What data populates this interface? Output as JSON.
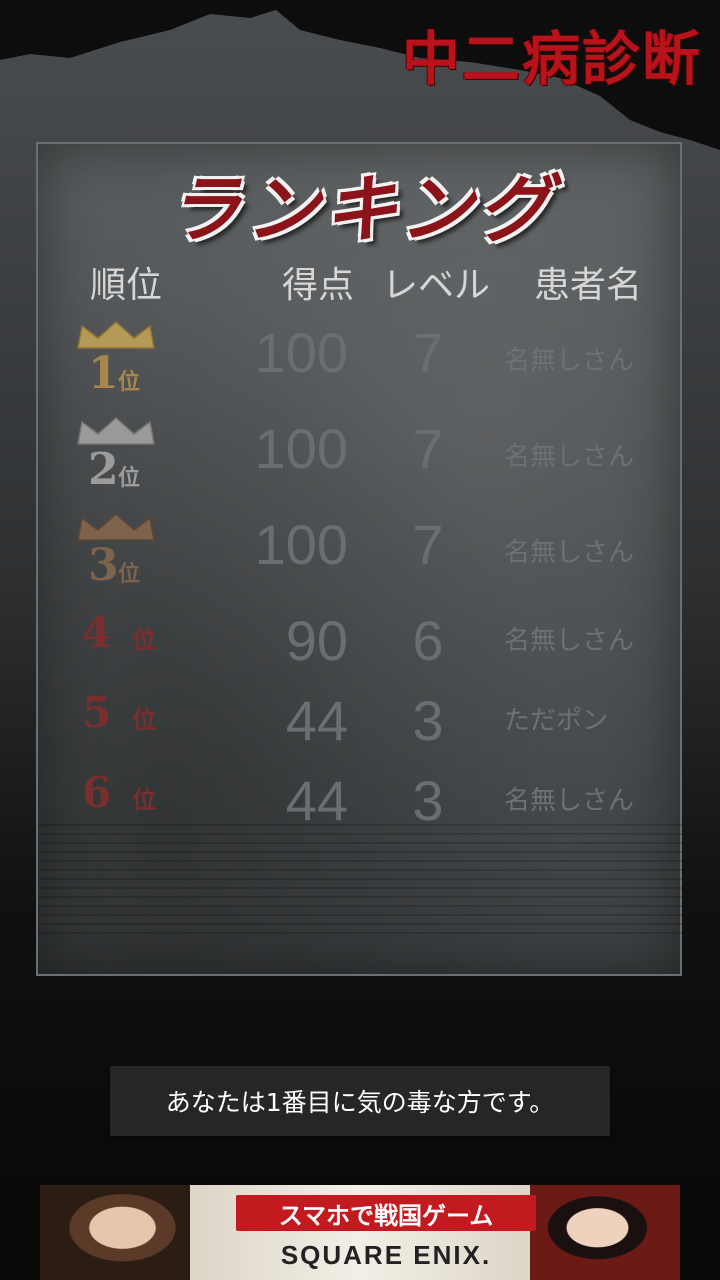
{
  "app": {
    "title": "中二病診断",
    "accent_color": "#b8121a"
  },
  "ranking": {
    "title": "ランキング",
    "headers": {
      "rank": "順位",
      "score": "得点",
      "level": "レベル",
      "name": "患者名"
    },
    "rows": [
      {
        "rank": "1",
        "suffix": "位",
        "score": "100",
        "level": "7",
        "name": "名無しさん",
        "medal": "gold",
        "color": "#b08a3c"
      },
      {
        "rank": "2",
        "suffix": "位",
        "score": "100",
        "level": "7",
        "name": "名無しさん",
        "medal": "silver",
        "color": "#a9a9a9"
      },
      {
        "rank": "3",
        "suffix": "位",
        "score": "100",
        "level": "7",
        "name": "名無しさん",
        "medal": "bronze",
        "color": "#8a6a50"
      },
      {
        "rank": "4",
        "suffix": "位",
        "score": "90",
        "level": "6",
        "name": "名無しさん",
        "medal": "none",
        "color": "#7a2a2a"
      },
      {
        "rank": "5",
        "suffix": "位",
        "score": "44",
        "level": "3",
        "name": "ただポン",
        "medal": "none",
        "color": "#7a2a2a"
      },
      {
        "rank": "6",
        "suffix": "位",
        "score": "44",
        "level": "3",
        "name": "名無しさん",
        "medal": "none",
        "color": "#7a2a2a"
      }
    ]
  },
  "toast": {
    "message": "あなたは1番目に気の毒な方です。"
  },
  "ad": {
    "line1": "スマホで戦国ゲーム",
    "line2": "SQUARE ENIX."
  }
}
